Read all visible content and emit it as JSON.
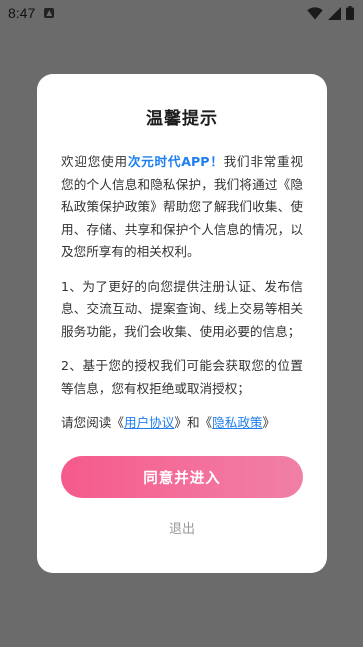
{
  "status_bar": {
    "time": "8:47"
  },
  "dialog": {
    "title": "温馨提示",
    "intro": {
      "prefix": "欢迎您使用",
      "brand": "次元时代APP！",
      "middle": "我们非常重视您的个人信息和隐私保护，我们将通过",
      "policy_ref": "《隐私政策保护政策》",
      "suffix": "帮助您了解我们收集、使用、存储、共享和保护个人信息的情况，以及您所享有的相关权利。"
    },
    "point1": "1、为了更好的向您提供注册认证、发布信息、交流互动、提案查询、线上交易等相关服务功能，我们会收集、使用必要的信息；",
    "point2": "2、基于您的授权我们可能会获取您的位置等信息，您有权拒绝或取消授权；",
    "read_line": {
      "prefix": "请您阅读《",
      "user_agreement": "用户协议",
      "middle": "》和《",
      "privacy_policy": "隐私政策",
      "suffix": "》"
    },
    "agree_button": "同意并进入",
    "exit_button": "退出"
  },
  "colors": {
    "accent": "#1e7ff0",
    "button_gradient_start": "#f55a8b",
    "button_gradient_end": "#f07fa6",
    "overlay": "#6b6b6b"
  }
}
